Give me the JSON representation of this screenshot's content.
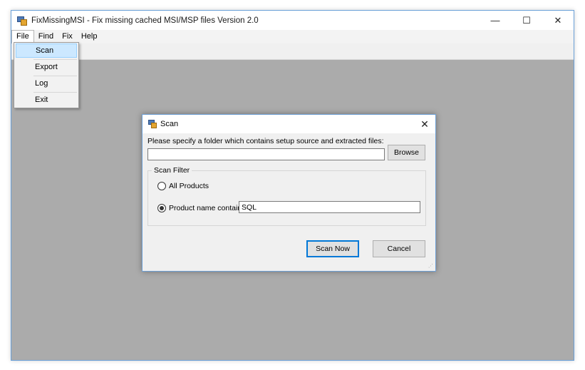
{
  "window": {
    "title": "FixMissingMSI - Fix missing cached MSI/MSP files  Version 2.0",
    "controls": {
      "minimize": "—",
      "maximize": "☐",
      "close": "✕"
    }
  },
  "menubar": {
    "items": [
      {
        "label": "File"
      },
      {
        "label": "Find"
      },
      {
        "label": "Fix"
      },
      {
        "label": "Help"
      }
    ]
  },
  "file_menu": {
    "items": [
      {
        "label": "Scan"
      },
      {
        "label": "Export"
      },
      {
        "label": "Log"
      },
      {
        "label": "Exit"
      }
    ]
  },
  "scan_dialog": {
    "title": "Scan",
    "close": "✕",
    "folder_label": "Please specify a folder which contains setup source and extracted files:",
    "folder_value": "",
    "browse_label": "Browse",
    "filter_group_label": "Scan Filter",
    "radio_all_label": "All Products",
    "radio_name_label": "Product name contains:",
    "product_name_value": "SQL",
    "scan_now_label": "Scan Now",
    "cancel_label": "Cancel",
    "selected_filter": "Product name contains:"
  },
  "colors": {
    "accent": "#0078d7",
    "workspace": "#ababab",
    "menu_highlight": "#cce8ff"
  }
}
